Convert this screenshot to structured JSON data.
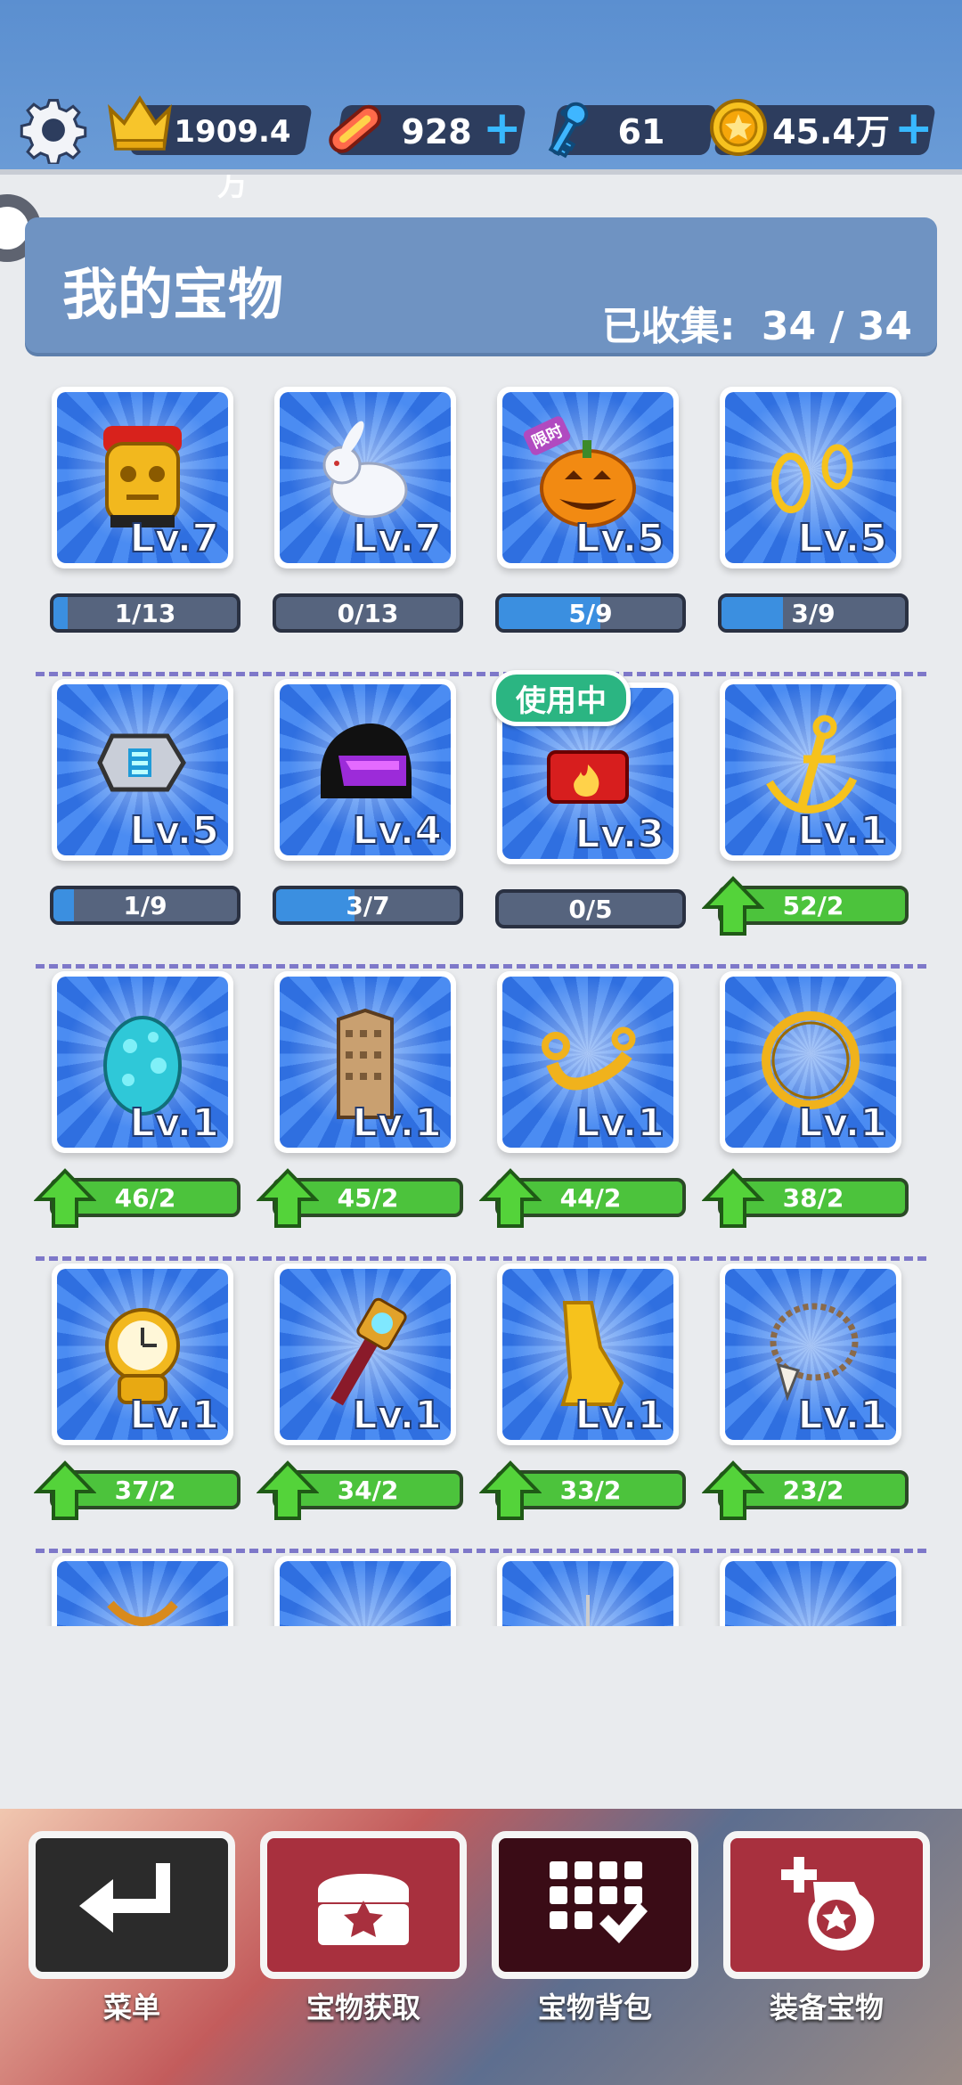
{
  "resources": [
    {
      "name": "crown",
      "icon": "crown-icon",
      "value": "1909.4万",
      "has_plus": false
    },
    {
      "name": "hoverboard",
      "icon": "hoverboard-icon",
      "value": "928",
      "has_plus": true
    },
    {
      "name": "key",
      "icon": "key-icon",
      "value": "61",
      "has_plus": true
    },
    {
      "name": "coin",
      "icon": "coin-icon",
      "value": "45.4万",
      "has_plus": true
    }
  ],
  "plus_symbol": "+",
  "header": {
    "title": "我的宝物",
    "collected_label": "已收集:",
    "collected_value": "34 / 34"
  },
  "items": [
    {
      "icon": "golden-idol-icon",
      "level": "Lv.7",
      "progress": "1/13",
      "fraction": 0.0769,
      "upgradable": false
    },
    {
      "icon": "white-rabbit-icon",
      "level": "Lv.7",
      "progress": "0/13",
      "fraction": 0,
      "upgradable": false
    },
    {
      "icon": "pumpkin-icon",
      "level": "Lv.5",
      "progress": "5/9",
      "fraction": 0.5556,
      "upgradable": false,
      "tag": "限时"
    },
    {
      "icon": "gold-rings-icon",
      "level": "Lv.5",
      "progress": "3/9",
      "fraction": 0.3333,
      "upgradable": false
    },
    {
      "icon": "gadget-watch-icon",
      "level": "Lv.5",
      "progress": "1/9",
      "fraction": 0.1111,
      "upgradable": false
    },
    {
      "icon": "helmet-icon",
      "level": "Lv.4",
      "progress": "3/7",
      "fraction": 0.4286,
      "upgradable": false
    },
    {
      "icon": "fire-cap-icon",
      "level": "Lv.3",
      "progress": "0/5",
      "fraction": 0,
      "upgradable": false,
      "in_use": "使用中"
    },
    {
      "icon": "anchor-icon",
      "level": "Lv.1",
      "progress": "52/2",
      "fraction": 1,
      "upgradable": true
    },
    {
      "icon": "dragon-egg-icon",
      "level": "Lv.1",
      "progress": "46/2",
      "fraction": 1,
      "upgradable": true
    },
    {
      "icon": "skyscraper-icon",
      "level": "Lv.1",
      "progress": "45/2",
      "fraction": 1,
      "upgradable": true
    },
    {
      "icon": "gold-scroll-icon",
      "level": "Lv.1",
      "progress": "44/2",
      "fraction": 1,
      "upgradable": true
    },
    {
      "icon": "gold-ring-icon",
      "level": "Lv.1",
      "progress": "38/2",
      "fraction": 1,
      "upgradable": true
    },
    {
      "icon": "pocket-watch-icon",
      "level": "Lv.1",
      "progress": "37/2",
      "fraction": 1,
      "upgradable": true
    },
    {
      "icon": "magic-torch-icon",
      "level": "Lv.1",
      "progress": "34/2",
      "fraction": 1,
      "upgradable": true
    },
    {
      "icon": "gold-boot-icon",
      "level": "Lv.1",
      "progress": "33/2",
      "fraction": 1,
      "upgradable": true
    },
    {
      "icon": "tooth-necklace-icon",
      "level": "Lv.1",
      "progress": "23/2",
      "fraction": 1,
      "upgradable": true
    }
  ],
  "partial_items": [
    {
      "icon": "chain-trophy-icon"
    },
    {
      "icon": "crab-helmet-icon"
    },
    {
      "icon": "fishing-hook-icon"
    },
    {
      "icon": "red-figure-icon"
    }
  ],
  "bottom_nav": [
    {
      "label": "菜单",
      "icon": "return-arrow-icon",
      "color": "#2b2b2b"
    },
    {
      "label": "宝物获取",
      "icon": "treasure-chest-icon",
      "color": "#a8303e"
    },
    {
      "label": "宝物背包",
      "icon": "grid-check-icon",
      "color": "#3a0c16"
    },
    {
      "label": "装备宝物",
      "icon": "equip-treasure-icon",
      "color": "#a8303e"
    }
  ]
}
